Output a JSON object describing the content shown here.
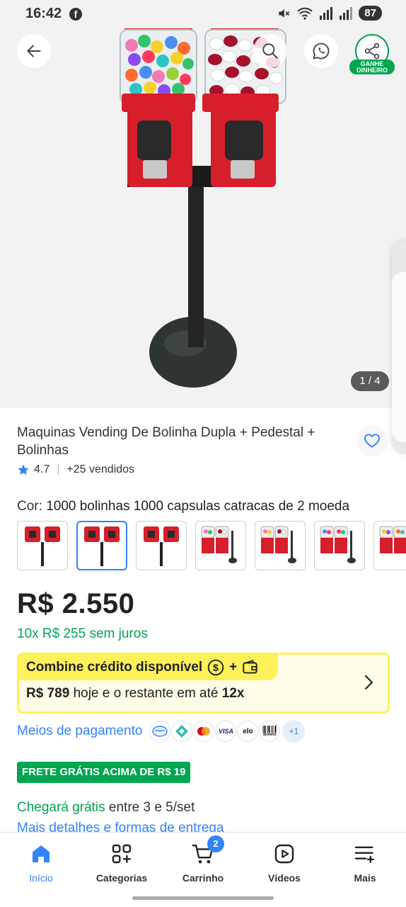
{
  "status_bar": {
    "time": "16:42",
    "battery": "87"
  },
  "hero": {
    "image_counter": "1 / 4",
    "share_label_line1": "GANHE",
    "share_label_line2": "DINHEIRO"
  },
  "product": {
    "title": "Maquinas Vending De Bolinha Dupla + Pedestal + Bolinhas",
    "rating": "4.7",
    "sold": "+25 vendidos",
    "color_label": "Cor:",
    "color_value": "1000 bolinhas 1000 capsulas catracas de 2 moeda",
    "price": "R$ 2.550",
    "installments": "10x R$ 255 sem juros"
  },
  "credit": {
    "header": "Combine crédito disponível",
    "amount": "R$ 789",
    "text_middle": "hoje e o restante em até",
    "times": "12x"
  },
  "payment": {
    "link": "Meios de pagamento",
    "methods": [
      "mercado-pago",
      "pix",
      "mastercard",
      "VISA",
      "elo",
      "Boleto"
    ],
    "more": "+1"
  },
  "shipping": {
    "free_badge": "FRETE GRÁTIS ACIMA DE R$ 19",
    "arrival_green": "Chegará grátis",
    "arrival_rest": "entre 3 e 5/set",
    "details_link": "Mais detalhes e formas de entrega"
  },
  "bottom_nav": {
    "items": [
      {
        "label": "Início",
        "icon": "home-icon"
      },
      {
        "label": "Categorias",
        "icon": "categories-icon"
      },
      {
        "label": "Carrinho",
        "icon": "cart-icon"
      },
      {
        "label": "Vídeos",
        "icon": "videos-icon"
      },
      {
        "label": "Mais",
        "icon": "menu-icon"
      }
    ],
    "cart_count": "2"
  },
  "colors": {
    "accent_blue": "#3483fa",
    "green": "#00a650",
    "yellow": "#fff159",
    "machine_red": "#d61f2b"
  }
}
